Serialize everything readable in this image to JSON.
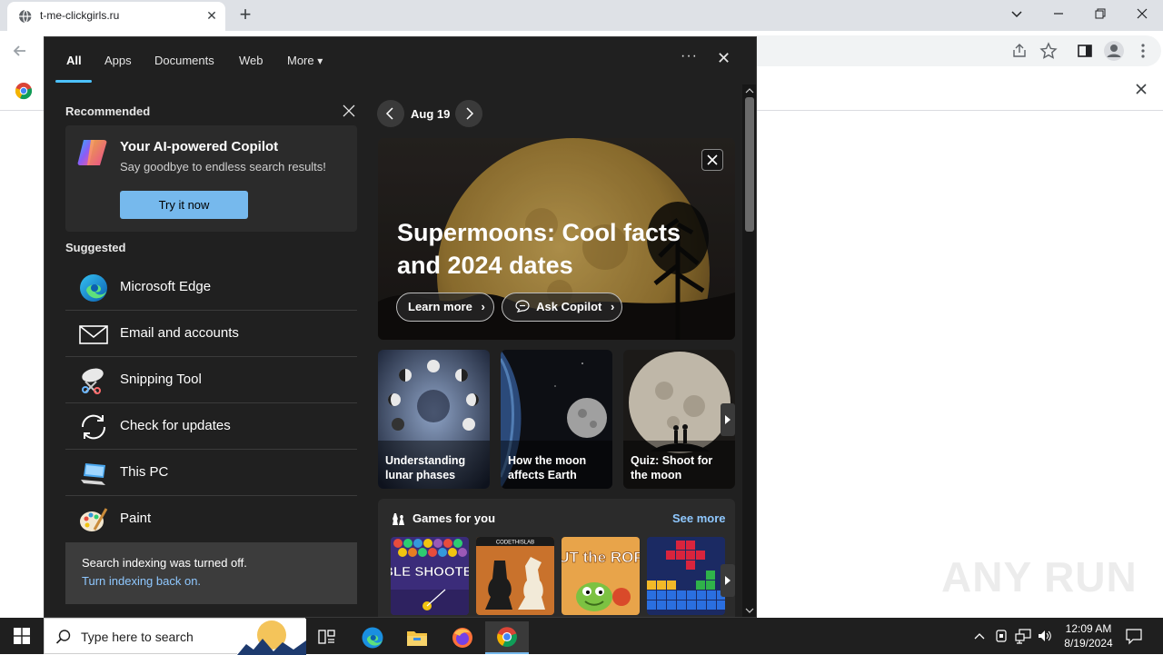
{
  "browser": {
    "tab_title": "t-me-clickgirls.ru",
    "tab_close": "✕",
    "new_tab": "+"
  },
  "search_panel": {
    "tabs": [
      "All",
      "Apps",
      "Documents",
      "Web",
      "More"
    ],
    "more_caret": "▾",
    "options_label": "···",
    "close_label": "✕",
    "recommended_label": "Recommended",
    "copilot": {
      "title": "Your AI-powered Copilot",
      "subtitle": "Say goodbye to endless search results!",
      "button": "Try it now"
    },
    "suggested_label": "Suggested",
    "apps": [
      {
        "label": "Microsoft Edge",
        "icon": "edge-icon"
      },
      {
        "label": "Email and accounts",
        "icon": "mail-icon"
      },
      {
        "label": "Snipping Tool",
        "icon": "snipping-tool-icon"
      },
      {
        "label": "Check for updates",
        "icon": "refresh-icon"
      },
      {
        "label": "This PC",
        "icon": "computer-icon"
      },
      {
        "label": "Paint",
        "icon": "paint-icon"
      }
    ],
    "indexing": {
      "message": "Search indexing was turned off.",
      "link": "Turn indexing back on."
    },
    "date_label": "Aug 19",
    "hero": {
      "title": "Supermoons: Cool facts and 2024 dates",
      "learn_more": "Learn more",
      "ask_copilot": "Ask Copilot"
    },
    "thumbs": [
      {
        "label": "Understanding lunar phases"
      },
      {
        "label": "How the moon affects Earth"
      },
      {
        "label": "Quiz: Shoot for the moon"
      }
    ],
    "games": {
      "title": "Games for you",
      "see_more": "See more",
      "items": [
        "BUBBLE SHOOTER HD",
        "CODETHISLAB",
        "CUT the ROPE",
        ""
      ]
    }
  },
  "taskbar": {
    "search_placeholder": "Type here to search",
    "time": "12:09 AM",
    "date": "8/19/2024"
  },
  "watermark": "ANY RUN",
  "colors": {
    "accent": "#76b9ed",
    "panel_bg": "#202020",
    "link": "#8fc8ff"
  }
}
